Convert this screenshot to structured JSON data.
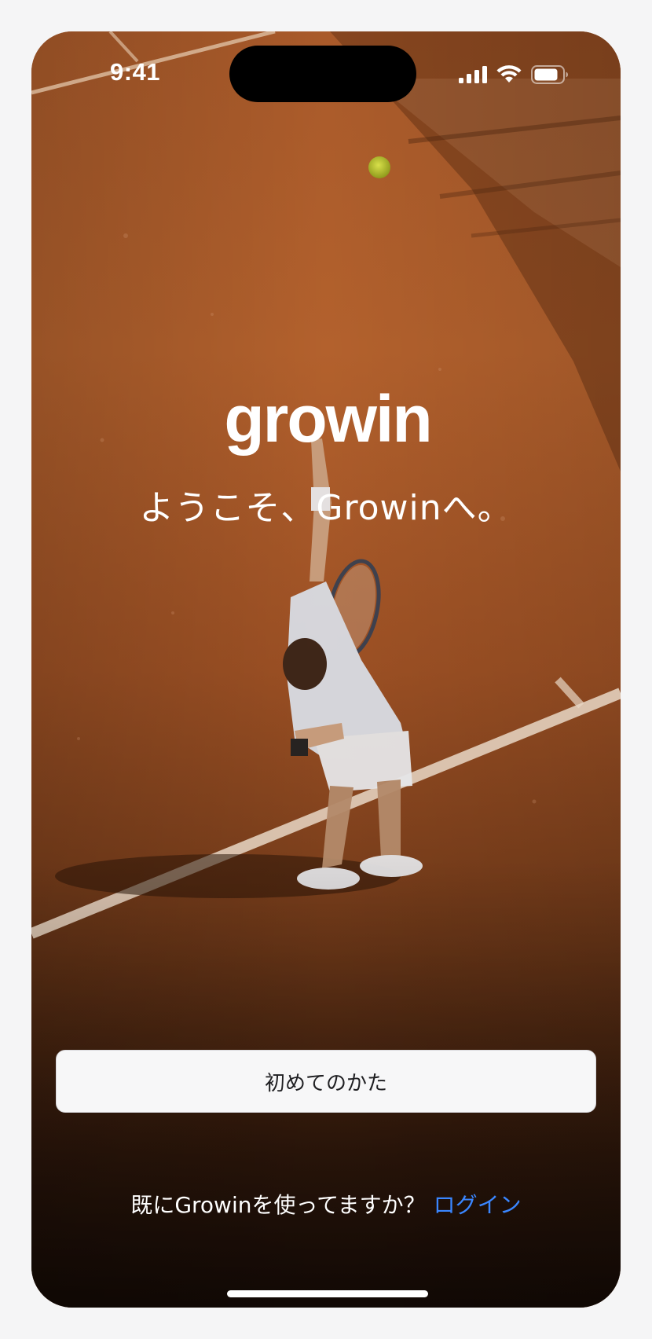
{
  "status_bar": {
    "time": "9:41"
  },
  "brand": {
    "logo_text": "growin"
  },
  "welcome": {
    "message": "ようこそ、Growinへ。"
  },
  "actions": {
    "primary_label": "初めてのかた",
    "existing_prompt": "既にGrowinを使ってますか？",
    "login_label": "ログイン"
  },
  "colors": {
    "clay": "#b9632e",
    "link": "#3a86ff",
    "button_bg": "#f7f7f8"
  },
  "icons": [
    "cellular-signal-icon",
    "wifi-icon",
    "battery-icon"
  ]
}
